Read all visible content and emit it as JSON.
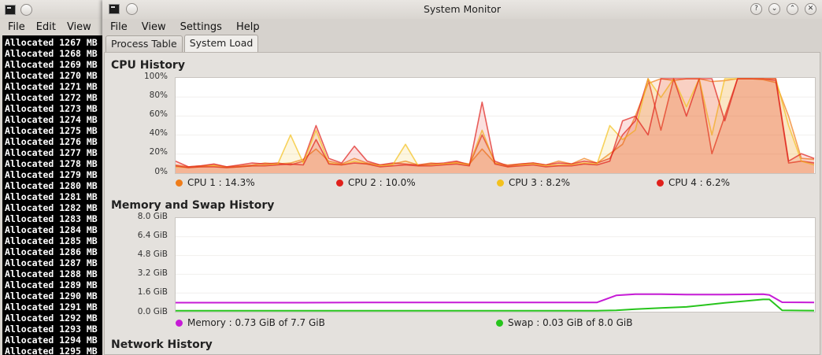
{
  "terminal": {
    "menu": [
      "File",
      "Edit",
      "View"
    ],
    "lines": [
      "Allocated 1267 MB",
      "Allocated 1268 MB",
      "Allocated 1269 MB",
      "Allocated 1270 MB",
      "Allocated 1271 MB",
      "Allocated 1272 MB",
      "Allocated 1273 MB",
      "Allocated 1274 MB",
      "Allocated 1275 MB",
      "Allocated 1276 MB",
      "Allocated 1277 MB",
      "Allocated 1278 MB",
      "Allocated 1279 MB",
      "Allocated 1280 MB",
      "Allocated 1281 MB",
      "Allocated 1282 MB",
      "Allocated 1283 MB",
      "Allocated 1284 MB",
      "Allocated 1285 MB",
      "Allocated 1286 MB",
      "Allocated 1287 MB",
      "Allocated 1288 MB",
      "Allocated 1289 MB",
      "Allocated 1290 MB",
      "Allocated 1291 MB",
      "Allocated 1292 MB",
      "Allocated 1293 MB",
      "Allocated 1294 MB",
      "Allocated 1295 MB"
    ]
  },
  "sysmon": {
    "title": "System Monitor",
    "menu": {
      "file": "File",
      "view": "View",
      "settings": "Settings",
      "help": "Help"
    },
    "window_buttons": {
      "help": "?",
      "minimize": "⌄",
      "maximize": "⌃",
      "close": "✕"
    },
    "tabs": {
      "process_table": "Process Table",
      "system_load": "System Load"
    },
    "cpu": {
      "title": "CPU History",
      "yticks": [
        "100%",
        "80%",
        "60%",
        "40%",
        "20%",
        "0%"
      ],
      "legend": [
        {
          "name": "CPU 1 : ",
          "value": "14.3%",
          "color": "#ef7d1a"
        },
        {
          "name": "CPU 2 : ",
          "value": "10.0%",
          "color": "#e0201b"
        },
        {
          "name": "CPU 3 : ",
          "value": "8.2%",
          "color": "#f3c11d"
        },
        {
          "name": "CPU 4 : ",
          "value": "6.2%",
          "color": "#e0201b"
        }
      ]
    },
    "memory": {
      "title": "Memory and Swap History",
      "yticks": [
        "8.0 GiB",
        "6.4 GiB",
        "4.8 GiB",
        "3.2 GiB",
        "1.6 GiB",
        "0.0 GiB"
      ],
      "legend": [
        {
          "name": "Memory : ",
          "value": "0.73 GiB of 7.7 GiB",
          "color": "#c61bd6"
        },
        {
          "name": "Swap : ",
          "value": "0.03 GiB of 8.0 GiB",
          "color": "#27c41c"
        }
      ]
    },
    "network": {
      "title": "Network History"
    }
  },
  "chart_data": [
    {
      "type": "area",
      "title": "CPU History",
      "ylim": [
        0,
        100
      ],
      "unit": "%",
      "x": [
        0,
        2,
        4,
        6,
        8,
        10,
        12,
        14,
        16,
        18,
        20,
        22,
        24,
        26,
        28,
        30,
        32,
        34,
        36,
        38,
        40,
        42,
        44,
        46,
        48,
        50,
        52,
        54,
        56,
        58,
        60,
        62,
        64,
        66,
        68,
        70,
        72,
        74,
        76,
        78,
        80,
        82,
        84,
        86,
        88,
        90,
        92,
        94,
        96,
        98,
        100
      ],
      "series": [
        {
          "name": "CPU 1",
          "color": "#ef7d1a",
          "values": [
            8,
            6,
            7,
            8,
            6,
            7,
            8,
            10,
            9,
            10,
            14,
            25,
            12,
            9,
            15,
            10,
            8,
            9,
            12,
            8,
            10,
            9,
            11,
            9,
            25,
            10,
            8,
            9,
            10,
            8,
            12,
            9,
            15,
            10,
            20,
            30,
            60,
            95,
            100,
            98,
            100,
            100,
            97,
            98,
            100,
            100,
            99,
            96,
            60,
            15,
            14
          ]
        },
        {
          "name": "CPU 2",
          "color": "#e0201b",
          "values": [
            12,
            6,
            7,
            9,
            6,
            8,
            10,
            9,
            10,
            8,
            12,
            50,
            15,
            10,
            28,
            12,
            8,
            10,
            9,
            8,
            9,
            10,
            12,
            8,
            40,
            12,
            7,
            9,
            10,
            8,
            10,
            9,
            12,
            10,
            15,
            40,
            55,
            100,
            45,
            100,
            100,
            100,
            20,
            60,
            100,
            100,
            100,
            98,
            10,
            12,
            10
          ]
        },
        {
          "name": "CPU 3",
          "color": "#f3c11d",
          "values": [
            6,
            5,
            6,
            7,
            5,
            6,
            7,
            8,
            9,
            40,
            10,
            45,
            10,
            8,
            12,
            9,
            7,
            8,
            30,
            7,
            8,
            9,
            10,
            8,
            45,
            10,
            6,
            8,
            9,
            7,
            8,
            8,
            10,
            9,
            50,
            35,
            45,
            100,
            80,
            100,
            70,
            100,
            40,
            100,
            100,
            100,
            100,
            100,
            50,
            12,
            8
          ]
        },
        {
          "name": "CPU 4",
          "color": "#e0201b",
          "values": [
            7,
            5,
            6,
            6,
            5,
            6,
            7,
            7,
            8,
            9,
            8,
            35,
            9,
            8,
            10,
            9,
            6,
            7,
            8,
            7,
            7,
            8,
            9,
            7,
            75,
            9,
            6,
            7,
            8,
            6,
            7,
            7,
            9,
            8,
            12,
            55,
            60,
            40,
            100,
            100,
            60,
            100,
            100,
            55,
            100,
            100,
            100,
            100,
            12,
            20,
            15
          ]
        }
      ]
    },
    {
      "type": "line",
      "title": "Memory and Swap History",
      "ylim": [
        0,
        8
      ],
      "unit": "GiB",
      "x": [
        0,
        10,
        20,
        30,
        40,
        50,
        60,
        66,
        69,
        72,
        76,
        80,
        86,
        92,
        93,
        95,
        100
      ],
      "series": [
        {
          "name": "Memory",
          "color": "#c61bd6",
          "values": [
            0.72,
            0.72,
            0.72,
            0.73,
            0.73,
            0.73,
            0.73,
            0.74,
            1.35,
            1.45,
            1.45,
            1.42,
            1.42,
            1.45,
            1.38,
            0.75,
            0.73
          ]
        },
        {
          "name": "Swap",
          "color": "#27c41c",
          "values": [
            0.02,
            0.02,
            0.02,
            0.02,
            0.02,
            0.02,
            0.02,
            0.02,
            0.05,
            0.15,
            0.25,
            0.35,
            0.7,
            1.0,
            1.0,
            0.05,
            0.03
          ]
        }
      ]
    }
  ]
}
